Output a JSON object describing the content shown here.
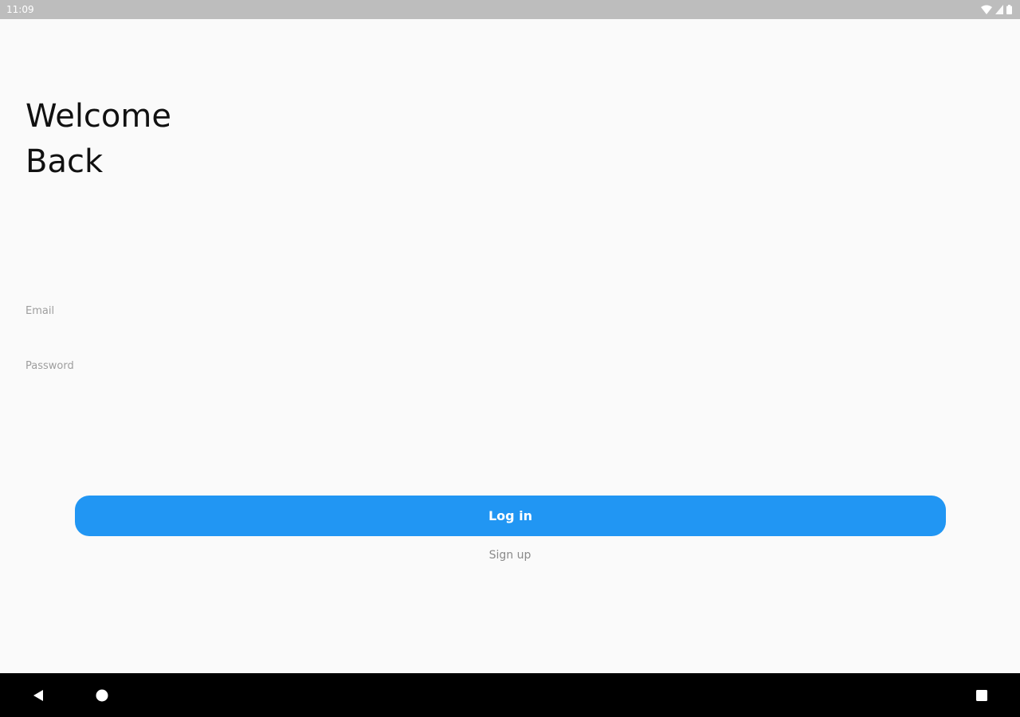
{
  "status_bar": {
    "time": "11:09",
    "icons": [
      "wifi-icon",
      "signal-icon",
      "battery-icon"
    ]
  },
  "header": {
    "line1": "Welcome",
    "line2": "Back"
  },
  "form": {
    "email_placeholder": "Email",
    "password_placeholder": "Password",
    "login_label": "Log in",
    "signup_label": "Sign up"
  },
  "nav_bar": {
    "icons": [
      "back-icon",
      "home-icon",
      "recents-icon"
    ]
  },
  "colors": {
    "accent": "#2196f3",
    "background": "#fafafa",
    "status_bar": "#bdbdbd",
    "nav_bar": "#000000"
  }
}
